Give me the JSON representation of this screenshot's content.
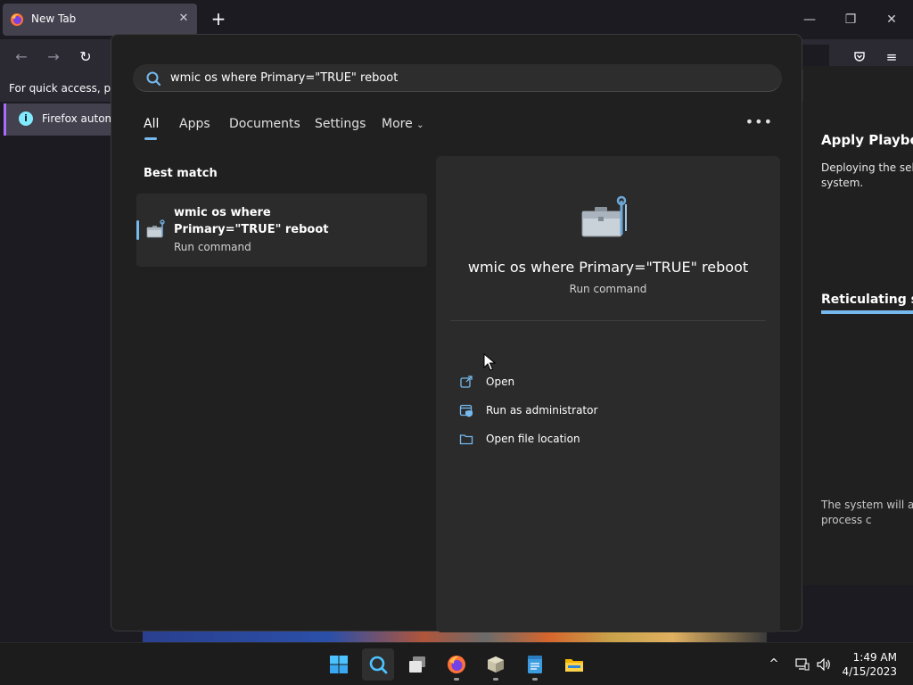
{
  "browser": {
    "tab_title": "New Tab",
    "bookmarks_hint": "For quick access, plac",
    "notice_text": "Firefox automa"
  },
  "right_pane": {
    "title": "Apply Playboo",
    "text": "Deploying the sele system.",
    "subtitle": "Reticulating sp",
    "footer": "The system will au once the process c"
  },
  "search": {
    "query": "wmic os where Primary=\"TRUE\" reboot",
    "filters": [
      "All",
      "Apps",
      "Documents",
      "Settings",
      "More"
    ],
    "more_icon": "chevron-down-icon",
    "best_match_label": "Best match",
    "result": {
      "title": "wmic os where Primary=\"TRUE\" reboot",
      "subtitle": "Run command"
    },
    "detail": {
      "title": "wmic os where Primary=\"TRUE\" reboot",
      "subtitle": "Run command",
      "actions": [
        "Open",
        "Run as administrator",
        "Open file location"
      ]
    }
  },
  "taskbar": {
    "time": "1:49 AM",
    "date": "4/15/2023"
  },
  "colors": {
    "accent": "#76b9ed",
    "panel_bg": "#202020",
    "card_bg": "#2b2b2b"
  }
}
